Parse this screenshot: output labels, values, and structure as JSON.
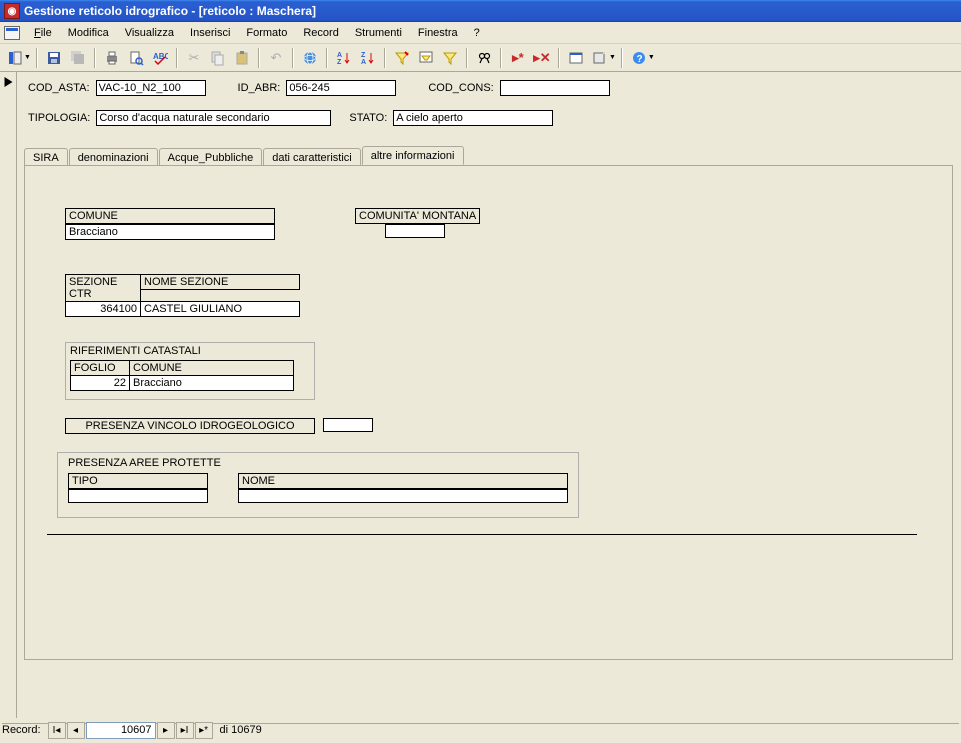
{
  "title": "Gestione reticolo idrografico - [reticolo : Maschera]",
  "menu": {
    "file": "File",
    "modifica": "Modifica",
    "visualizza": "Visualizza",
    "inserisci": "Inserisci",
    "formato": "Formato",
    "record": "Record",
    "strumenti": "Strumenti",
    "finestra": "Finestra",
    "help": "?"
  },
  "fields": {
    "cod_asta_label": "COD_ASTA:",
    "cod_asta_value": "VAC-10_N2_100",
    "id_abr_label": "ID_ABR:",
    "id_abr_value": "056-245",
    "cod_cons_label": "COD_CONS:",
    "cod_cons_value": "",
    "tipologia_label": "TIPOLOGIA:",
    "tipologia_value": "Corso d'acqua naturale secondario",
    "stato_label": "STATO:",
    "stato_value": "A cielo aperto"
  },
  "tabs": {
    "sira": "SIRA",
    "denominazioni": "denominazioni",
    "acque_pubbliche": "Acque_Pubbliche",
    "dati_caratteristici": "dati caratteristici",
    "altre_informazioni": "altre informazioni"
  },
  "panel": {
    "comune_label": "COMUNE",
    "comune_value": "Bracciano",
    "comunita_montana_label": "COMUNITA' MONTANA",
    "comunita_montana_value": "",
    "sezione_ctr_label": "SEZIONE CTR",
    "sezione_ctr_value": "364100",
    "nome_sezione_label": "NOME SEZIONE",
    "nome_sezione_value": "CASTEL GIULIANO",
    "riferimenti_catastali_title": "RIFERIMENTI CATASTALI",
    "foglio_label": "FOGLIO",
    "foglio_value": "22",
    "rc_comune_label": "COMUNE",
    "rc_comune_value": "Bracciano",
    "vincolo_label": "PRESENZA VINCOLO IDROGEOLOGICO",
    "vincolo_value": "",
    "aree_protette_title": "PRESENZA AREE PROTETTE",
    "tipo_label": "TIPO",
    "tipo_value": "",
    "nome_label": "NOME",
    "nome_value": ""
  },
  "nav": {
    "record_label": "Record:",
    "current": "10607",
    "of_text": "di 10679"
  }
}
